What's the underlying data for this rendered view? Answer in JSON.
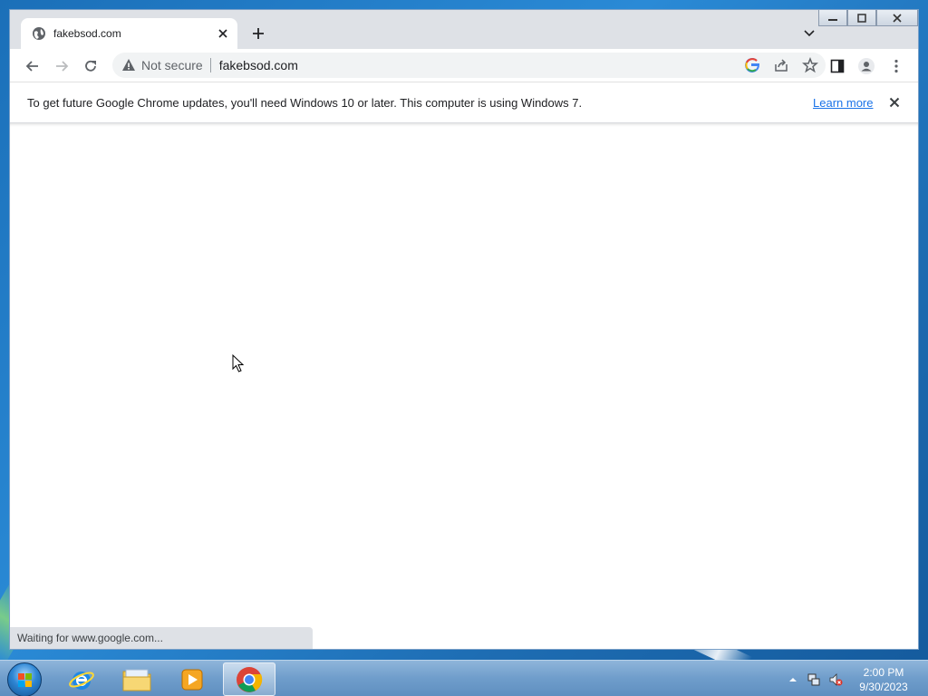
{
  "browser": {
    "tab": {
      "title": "fakebsod.com"
    },
    "omnibox": {
      "security_status": "Not secure",
      "url": "fakebsod.com"
    },
    "infobar": {
      "message": "To get future Google Chrome updates, you'll need Windows 10 or later. This computer is using Windows 7.",
      "link": "Learn more"
    },
    "status_bubble": "Waiting for www.google.com..."
  },
  "taskbar": {
    "items": [
      "internet-explorer",
      "file-explorer",
      "media-player",
      "google-chrome"
    ],
    "clock": {
      "time": "2:00 PM",
      "date": "9/30/2023"
    }
  },
  "colors": {
    "accent": "#1a73e8",
    "tab_strip": "#dee1e6"
  }
}
